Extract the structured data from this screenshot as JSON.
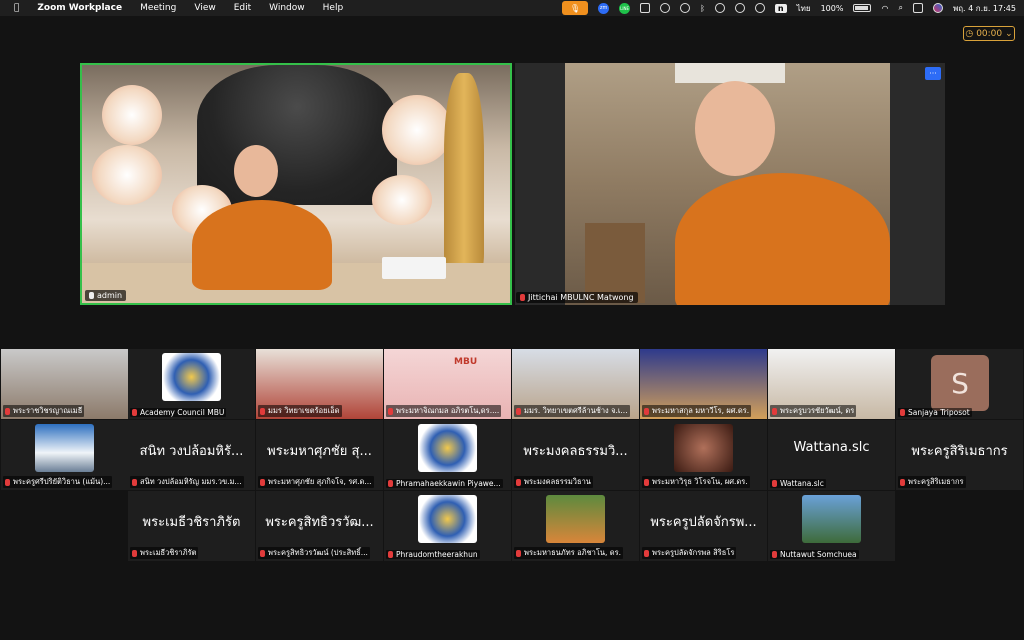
{
  "menubar": {
    "app": "Zoom Workplace",
    "menus": [
      "Meeting",
      "View",
      "Edit",
      "Window",
      "Help"
    ],
    "input_badge": "n",
    "input_lang": "ไทย",
    "battery": "100%",
    "datetime": "พฤ. 4 ก.ย.  17:45"
  },
  "timer": "00:00",
  "main_videos": [
    {
      "name": "admin",
      "muted": false
    },
    {
      "name": "Jittichai MBULNC Matwong",
      "muted": true
    }
  ],
  "more_button": "···",
  "gallery": [
    {
      "label": "พระราชวิชรญาณเมธี",
      "kind": "video"
    },
    {
      "label": "Academy Council MBU",
      "kind": "logo"
    },
    {
      "label": "มมร วิทยาเขตร้อยเอ็ด",
      "kind": "video"
    },
    {
      "label": "พระมหาจิณกมล อภิรตโน,ดร....",
      "kind": "slide",
      "slide_title": "MBU"
    },
    {
      "label": "มมร. วิทยาเขตศรีล้านช้าง จ.เ...",
      "kind": "video"
    },
    {
      "label": "พระมหาสกุล มหาวีโร, ผศ.ดร.",
      "kind": "video"
    },
    {
      "label": "พระครูบวรชัยวัฒน์, ดร",
      "kind": "video"
    },
    {
      "label": "Sanjaya Triposot",
      "kind": "avatar",
      "avatar": "S"
    },
    {
      "label": "พระครูศรีปริยัติวิธาน (แม้น)...",
      "kind": "thumb"
    },
    {
      "label": "สนิท วงปล้อมหิรัญ มมร.วข.ม...",
      "kind": "name",
      "bigname": "สนิท วงปล้อมหิรั..."
    },
    {
      "label": "พระมหาศุภชัย สุภกิจโจ, รศ.ด...",
      "kind": "name",
      "bigname": "พระมหาศุภชัย สุ..."
    },
    {
      "label": "Phramahaekkawin Piyawe...",
      "kind": "logo"
    },
    {
      "label": "พระมงคลธรรมวิธาน",
      "kind": "name",
      "bigname": "พระมงคลธรรมวิ..."
    },
    {
      "label": "พระมหาวิรุธ วิโรจโน, ผศ.ดร.",
      "kind": "thumb"
    },
    {
      "label": "Wattana.slc",
      "kind": "name",
      "bigname": "Wattana.slc"
    },
    {
      "label": "พระครูสิริเมธากร",
      "kind": "name",
      "bigname": "พระครูสิริเมธากร"
    },
    {
      "label": "พระเมธีวชิราภิรัต",
      "kind": "name",
      "bigname": "พระเมธีวชิราภิรัต"
    },
    {
      "label": "พระครูสิทธิวรวัฒน์ (ประสิทธิ์...",
      "kind": "name",
      "bigname": "พระครูสิทธิวรวัฒ..."
    },
    {
      "label": "Phraudomtheerakhun",
      "kind": "logo"
    },
    {
      "label": "พระมหาธนภัทร อภิชาโน, ดร.",
      "kind": "thumb"
    },
    {
      "label": "พระครูปลัดจักรพล สิริธโร",
      "kind": "name",
      "bigname": "พระครูปลัดจักรพ..."
    },
    {
      "label": "Nuttawut Somchuea",
      "kind": "thumb"
    }
  ],
  "colors": {
    "active_speaker": "#35c04a",
    "muted": "#e23b3b",
    "timer": "#e6b04d",
    "robe": "#d8731d"
  }
}
